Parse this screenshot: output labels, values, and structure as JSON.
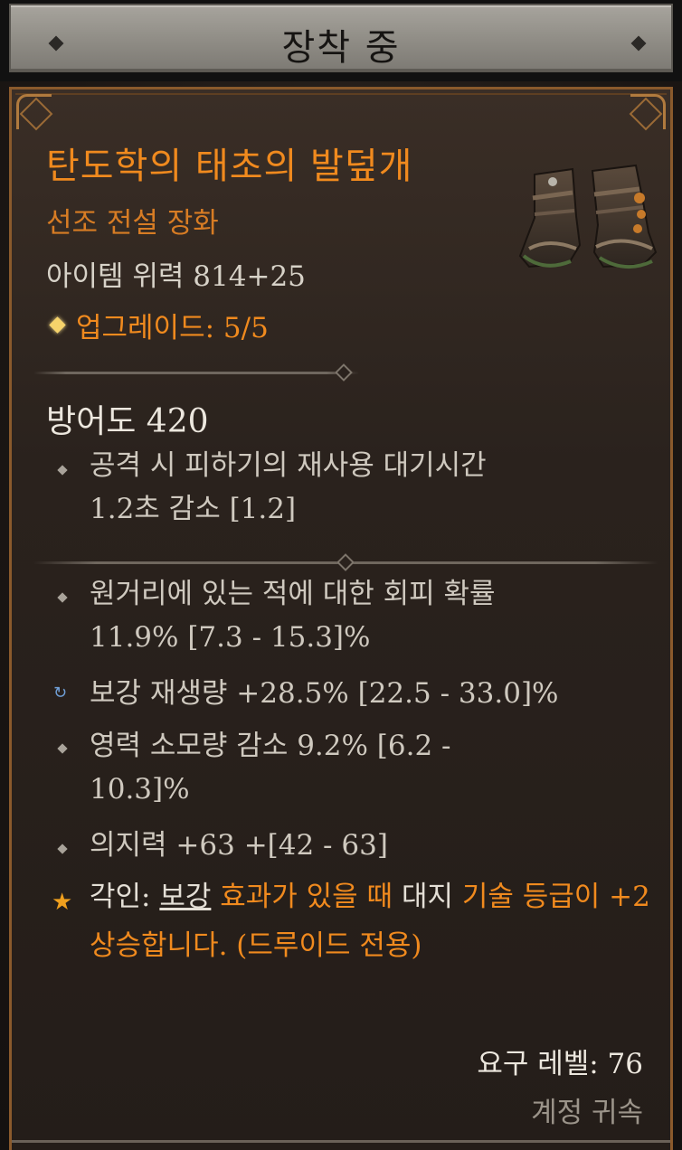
{
  "header": {
    "equipped_label": "장착 중"
  },
  "item": {
    "name": "탄도학의 태초의 발덮개",
    "type": "선조 전설 장화",
    "power": "아이템 위력 814+25",
    "upgrade": "업그레이드: 5/5",
    "image_icon": "boots-icon"
  },
  "armor": "방어도 420",
  "implicit_stats": [
    {
      "line1": "공격 시 피하기의 재사용 대기시간",
      "line2": "1.2초 감소 [1.2]"
    }
  ],
  "affixes": [
    {
      "line1": "원거리에 있는 적에 대한 회피 확률",
      "line2": "11.9% [7.3 - 15.3]%",
      "bullet": "diamond"
    },
    {
      "line1": "보강 재생량 +28.5% [22.5 - 33.0]%",
      "line2": "",
      "bullet": "tempered-cycle-icon"
    },
    {
      "line1": "영력 소모량 감소 9.2% [6.2 -",
      "line2": "10.3]%",
      "bullet": "diamond"
    },
    {
      "line1": "의지력 +63 +[42 - 63]",
      "line2": "",
      "bullet": "diamond"
    }
  ],
  "aspect": {
    "prefix": "각인: ",
    "keyword": "보강",
    "part1": " 효과가 있을 때 ",
    "white": "대지",
    "part2": " 기술 등급이 +2 상승합니다. (드루이드 전용)"
  },
  "footer": {
    "required_level": "요구 레벨: 76",
    "account_bound": "계정 귀속"
  },
  "colors": {
    "legendary_orange": "#f08a1e",
    "stat_text": "#cfc9bf",
    "border_gold": "#8a5a2c",
    "tempered_blue": "#6f9ed6"
  }
}
